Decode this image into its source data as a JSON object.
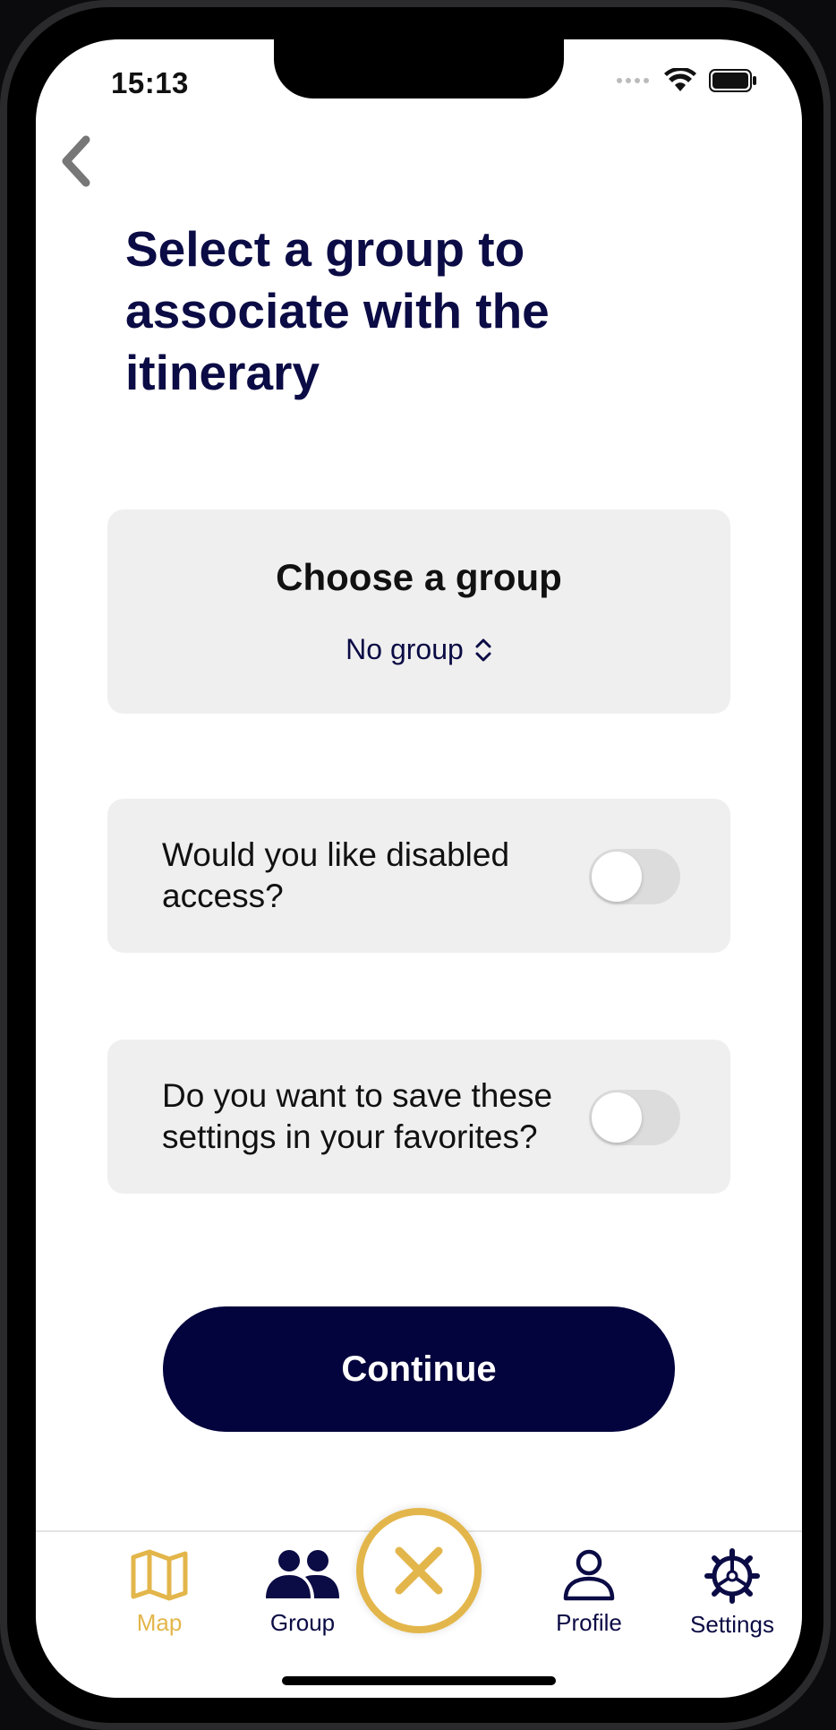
{
  "status": {
    "time": "15:13"
  },
  "page": {
    "title": "Select a group to associate with the itinerary"
  },
  "group_card": {
    "heading": "Choose a group",
    "selected_value": "No group"
  },
  "toggles": [
    {
      "label": "Would you like disabled access?",
      "on": false
    },
    {
      "label": "Do you want to save these settings in your favorites?",
      "on": false
    }
  ],
  "cta": {
    "label": "Continue"
  },
  "tabbar": {
    "items": [
      {
        "label": "Map",
        "icon": "map-icon",
        "active": true
      },
      {
        "label": "Group",
        "icon": "group-icon",
        "active": false
      },
      {
        "label": "",
        "icon": "close-icon",
        "active": false
      },
      {
        "label": "Profile",
        "icon": "profile-icon",
        "active": false
      },
      {
        "label": "Settings",
        "icon": "settings-icon",
        "active": false
      }
    ]
  },
  "colors": {
    "primary": "#03033d",
    "title": "#0b0b45",
    "accent": "#e3b64b",
    "card_bg": "#efefef"
  }
}
